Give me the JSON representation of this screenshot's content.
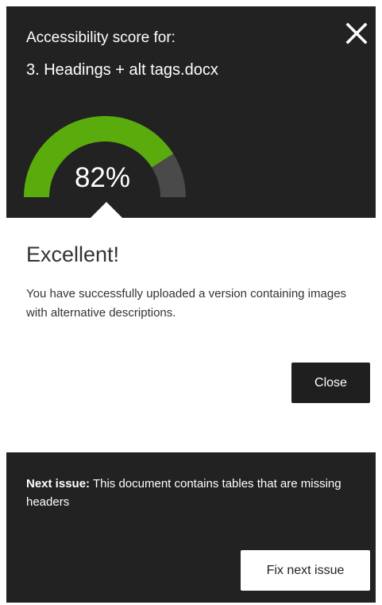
{
  "header": {
    "caption": "Accessibility score for:",
    "filename": "3. Headings + alt tags.docx",
    "close_icon": "close-icon"
  },
  "score": {
    "label": "82%",
    "value": 0.82,
    "fill_color": "#5aac0c",
    "track_color": "#4a4a4a"
  },
  "result": {
    "rating": "Excellent!",
    "message": "You have successfully uploaded a version containing images with alternative descriptions.",
    "close_label": "Close"
  },
  "next_issue": {
    "label": "Next issue:",
    "text": " This document contains tables that are missing headers",
    "fix_label": "Fix next issue"
  }
}
